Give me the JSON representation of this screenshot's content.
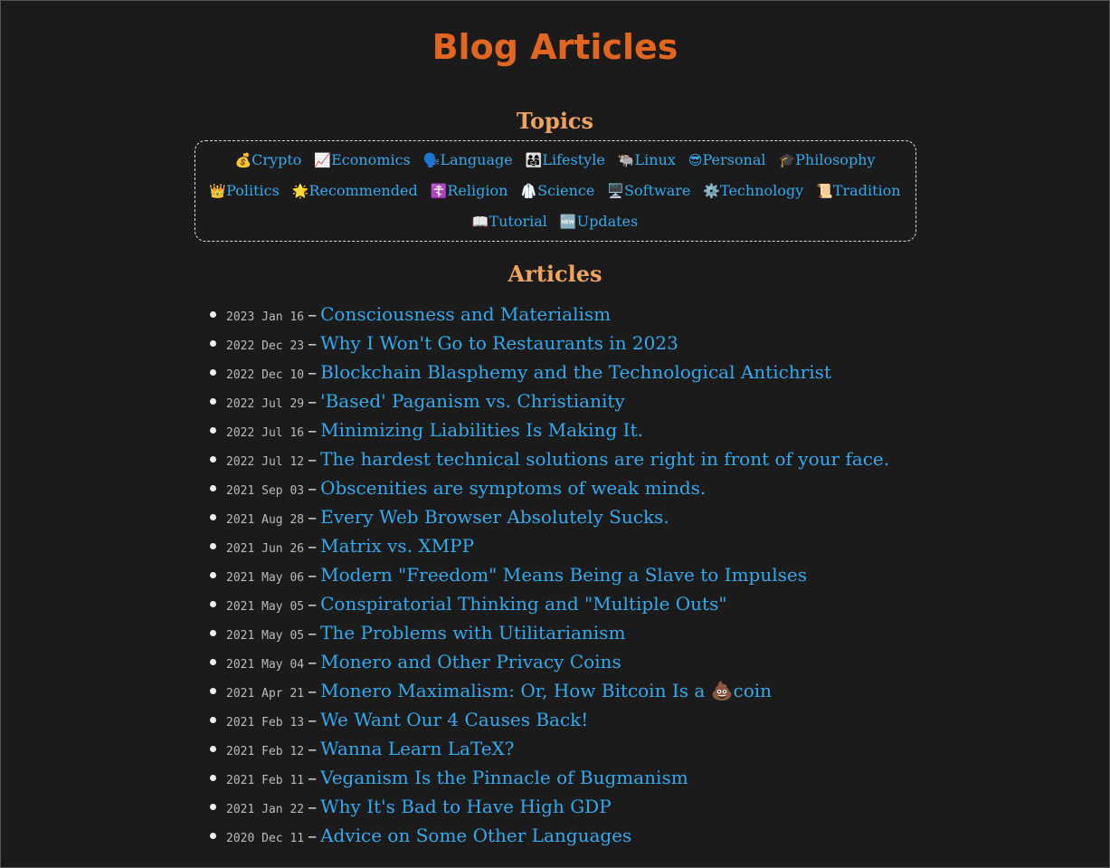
{
  "page": {
    "title": "Blog Articles"
  },
  "topics": {
    "heading": "Topics",
    "rows": [
      [
        {
          "icon": "💰",
          "label": "Crypto"
        },
        {
          "icon": "📈",
          "label": "Economics"
        },
        {
          "icon": "🗣️",
          "label": "Language"
        },
        {
          "icon": "👨‍👩‍👧",
          "label": "Lifestyle"
        },
        {
          "icon": "🐃",
          "label": "Linux"
        },
        {
          "icon": "😎",
          "label": "Personal"
        },
        {
          "icon": "🎓",
          "label": "Philosophy"
        }
      ],
      [
        {
          "icon": "👑",
          "label": "Politics"
        },
        {
          "icon": "🌟",
          "label": "Recommended"
        },
        {
          "icon": "☦️",
          "label": "Religion"
        },
        {
          "icon": "🥼",
          "label": "Science"
        },
        {
          "icon": "🖥️",
          "label": "Software"
        },
        {
          "icon": "⚙️",
          "label": "Technology"
        },
        {
          "icon": "📜",
          "label": "Tradition"
        }
      ],
      [
        {
          "icon": "📖",
          "label": "Tutorial"
        },
        {
          "icon": "🆕",
          "label": "Updates"
        }
      ]
    ]
  },
  "articles": {
    "heading": "Articles",
    "separator": "–",
    "items": [
      {
        "date": "2023 Jan 16",
        "title": "Consciousness and Materialism"
      },
      {
        "date": "2022 Dec 23",
        "title": "Why I Won't Go to Restaurants in 2023"
      },
      {
        "date": "2022 Dec 10",
        "title": "Blockchain Blasphemy and the Technological Antichrist"
      },
      {
        "date": "2022 Jul 29",
        "title": "'Based' Paganism vs. Christianity"
      },
      {
        "date": "2022 Jul 16",
        "title": "Minimizing Liabilities Is Making It."
      },
      {
        "date": "2022 Jul 12",
        "title": "The hardest technical solutions are right in front of your face."
      },
      {
        "date": "2021 Sep 03",
        "title": "Obscenities are symptoms of weak minds."
      },
      {
        "date": "2021 Aug 28",
        "title": "Every Web Browser Absolutely Sucks."
      },
      {
        "date": "2021 Jun 26",
        "title": "Matrix vs. XMPP"
      },
      {
        "date": "2021 May 06",
        "title": "Modern \"Freedom\" Means Being a Slave to Impulses"
      },
      {
        "date": "2021 May 05",
        "title": "Conspiratorial Thinking and \"Multiple Outs\""
      },
      {
        "date": "2021 May 05",
        "title": "The Problems with Utilitarianism"
      },
      {
        "date": "2021 May 04",
        "title": "Monero and Other Privacy Coins"
      },
      {
        "date": "2021 Apr 21",
        "title": "Monero Maximalism: Or, How Bitcoin Is a 💩coin"
      },
      {
        "date": "2021 Feb 13",
        "title": "We Want Our 4 Causes Back!"
      },
      {
        "date": "2021 Feb 12",
        "title": "Wanna Learn LaTeX?"
      },
      {
        "date": "2021 Feb 11",
        "title": "Veganism Is the Pinnacle of Bugmanism"
      },
      {
        "date": "2021 Jan 22",
        "title": "Why It's Bad to Have High GDP"
      },
      {
        "date": "2020 Dec 11",
        "title": "Advice on Some Other Languages"
      }
    ]
  }
}
